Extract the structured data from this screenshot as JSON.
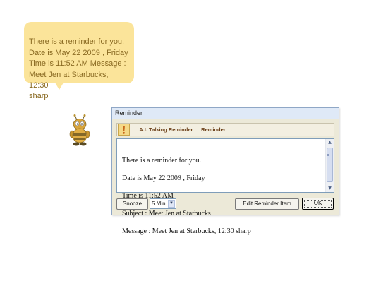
{
  "bubble": {
    "text": "There is a reminder for you.\nDate is May 22 2009 , Friday\nTime is 11:52 AM Message :\nMeet Jen at Starbucks, 12:30\nsharp"
  },
  "window": {
    "title": "Reminder",
    "header_title": "::: A.I. Talking Reminder ::: Reminder:",
    "message_lines": [
      "There is a reminder for you.",
      "Date is May 22 2009 , Friday",
      "Time is 11:52 AM",
      "Subject : Meet Jen at Starbucks",
      "Message : Meet Jen at Starbucks, 12:30 sharp"
    ],
    "snooze_label": "Snooze",
    "snooze_value": "5 Min",
    "edit_label": "Edit Reminder Item",
    "ok_label": "OK"
  },
  "icons": {
    "header_icon": "exclamation-icon",
    "character": "bee-character-icon",
    "scroll_up": "scroll-up-icon",
    "scroll_down": "scroll-down-icon",
    "dropdown": "dropdown-arrow-icon"
  },
  "colors": {
    "bubble_bg": "#fbe49a",
    "bubble_text": "#8a6a22",
    "header_title": "#6b3f18",
    "window_border": "#8fa7c6"
  }
}
